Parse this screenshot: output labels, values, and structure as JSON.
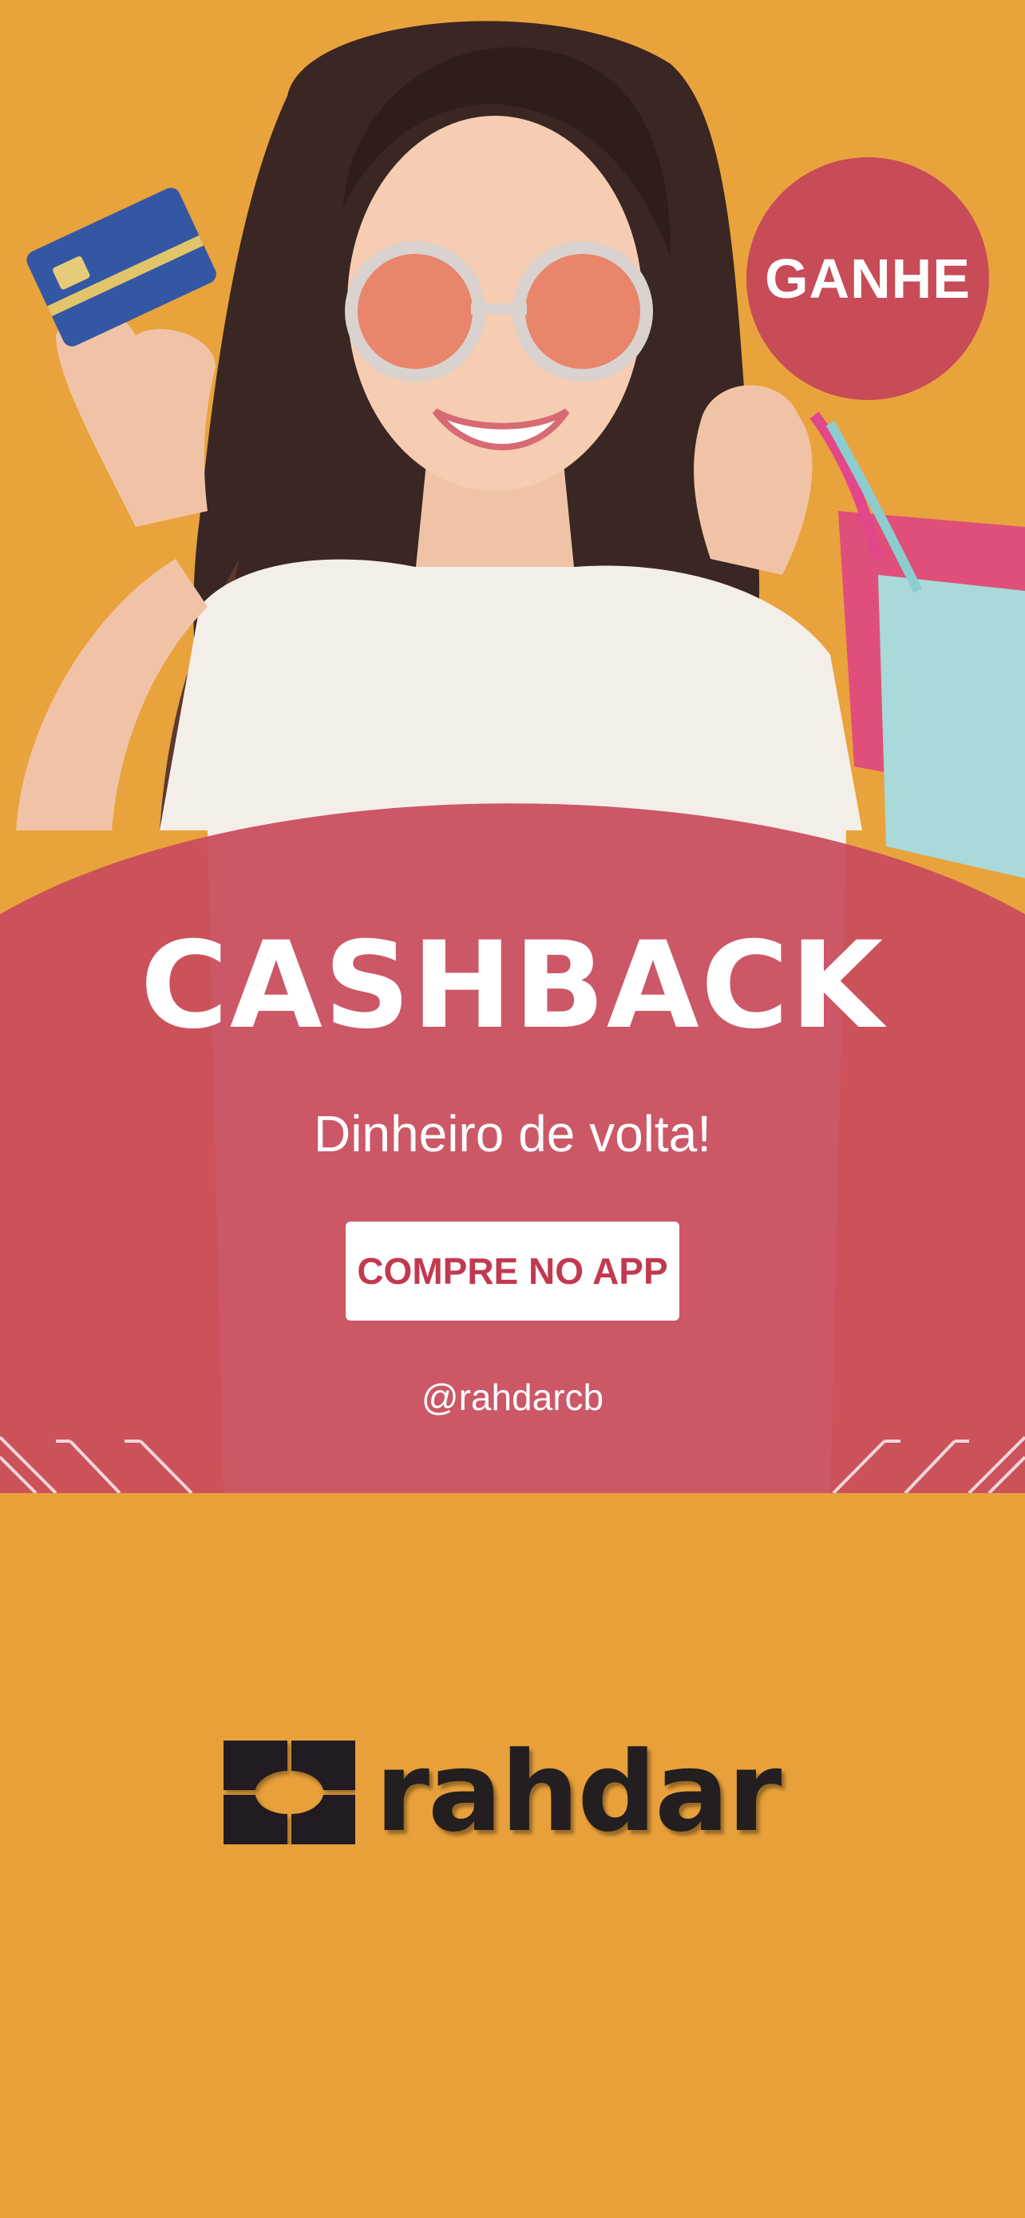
{
  "colors": {
    "background": "#E8A03A",
    "accent": "#C84B58",
    "cta_text": "#C2394F",
    "logo": "#231F20"
  },
  "hero": {
    "photo_description_icon": "woman-holding-card-and-bags-photo"
  },
  "badge": {
    "label": "GANHE"
  },
  "banner": {
    "headline": "CASHBACK",
    "subline": "Dinheiro de volta!",
    "cta_label": "COMPRE NO APP",
    "handle": "@rahdarcb"
  },
  "brand": {
    "name": "rahdar"
  }
}
